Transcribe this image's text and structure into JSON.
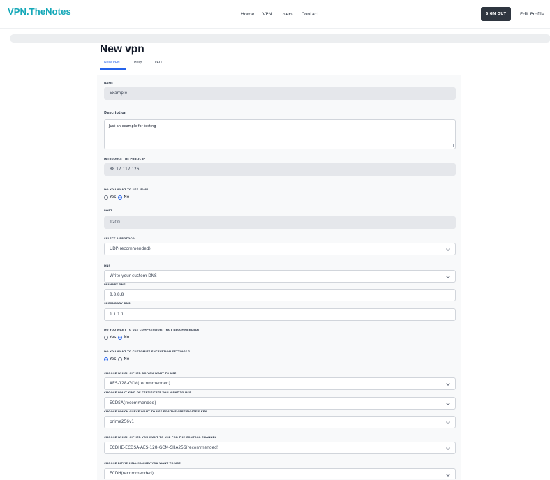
{
  "nav": {
    "brand": "VPN.TheNotes",
    "links": [
      "Home",
      "VPN",
      "Users",
      "Contact"
    ],
    "sign_out": "SIGN OUT",
    "edit_profile": "Edit Profile"
  },
  "page": {
    "title": "New vpn",
    "tabs": [
      "New VPN",
      "Help",
      "FAQ"
    ],
    "active_tab": "New VPN"
  },
  "form": {
    "name": {
      "label": "NAME",
      "value": "Example"
    },
    "description": {
      "label": "Description",
      "value": "Just an example for testing"
    },
    "public_ip": {
      "label": "INTRODUCE THE PUBLIC IP",
      "value": "88.17.117.126"
    },
    "ipv6": {
      "label": "DO YOU WANT TO USE IPV6?",
      "yes": "Yes",
      "no": "No",
      "selected": "No"
    },
    "port": {
      "label": "PORT",
      "value": "1200"
    },
    "protocol": {
      "label": "SELECT A PROTOCOL",
      "value": "UDP(recommended)"
    },
    "dns": {
      "label": "DNS",
      "value": "Write your custom DNS"
    },
    "primary_dns": {
      "label": "PRIMARY DNS",
      "value": "8.8.8.8"
    },
    "secondary_dns": {
      "label": "SECONDARY DNS",
      "value": "1.1.1.1"
    },
    "compression": {
      "label": "DO YOU WANT TO USE COMPRESSION? (NOT RECOMMENDED)",
      "yes": "Yes",
      "no": "No",
      "selected": "No"
    },
    "encryption": {
      "label": "DO YOU WANT TO CUSTOMIZE ENCRYPTION SETTINGS ?",
      "yes": "Yes",
      "no": "No",
      "selected": "Yes"
    },
    "cipher": {
      "label": "CHOOSE WHICH CIPHER DO YOU WANT TO USE",
      "value": "AES-128-GCM(recommended)"
    },
    "certificate": {
      "label": "CHOOSE WHAT KIND OF CERTIFICATE YOU WANT TO USE.",
      "value": "ECDSA(recommended)"
    },
    "curve": {
      "label": "CHOOSE WHICH CURVE WANT TO USE FOR THE CERTIFICATE'S KEY",
      "value": "prime256v1"
    },
    "control_cipher": {
      "label": "CHOOSE WHICH CIPHER YOU WANT TO USE FOR THE CONTROL CHANNEL",
      "value": "ECDHE-ECDSA-AES-128-GCM-SHA256(recommended)"
    },
    "dh_key": {
      "label": "CHOOSE DIFFIE-HELLMAN KEY YOU WANT TO USE",
      "value": "ECDH(recommended)"
    }
  },
  "colors": {
    "brand": "#15a8b8",
    "accent": "#2563eb",
    "button": "#2f3640"
  }
}
